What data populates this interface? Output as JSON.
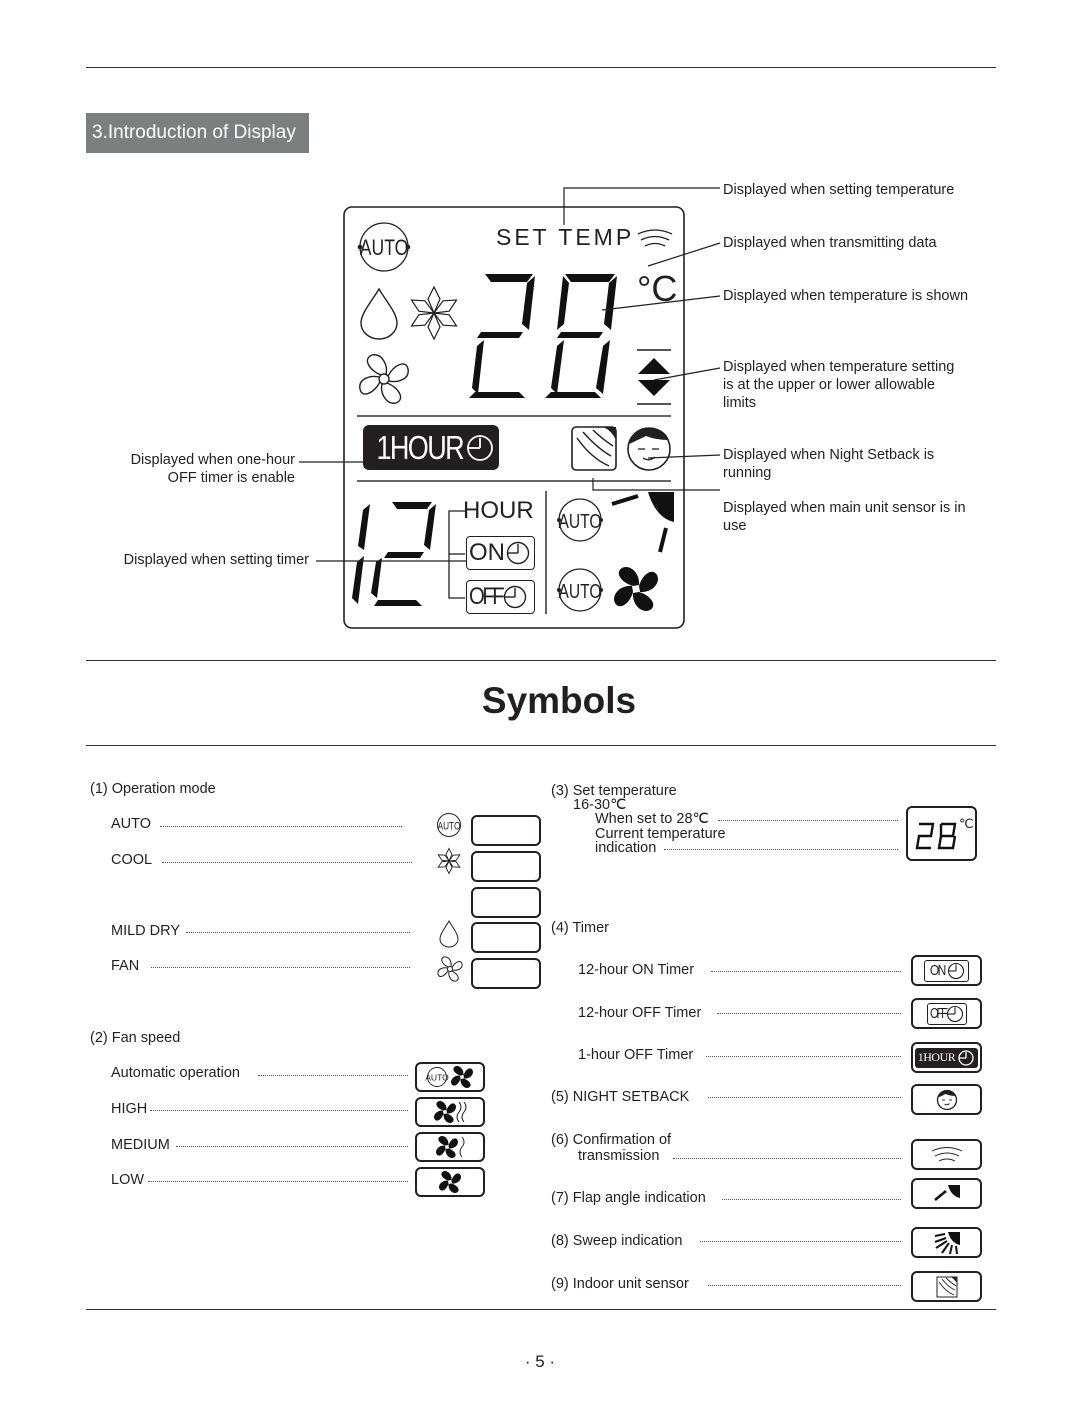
{
  "section": {
    "title": "3.Introduction of Display"
  },
  "display": {
    "set_temp_label": "SET TEMP",
    "temperature_digits": "28",
    "temperature_unit": "°C",
    "one_hour_label": "1HOUR",
    "timer_digits": "12",
    "hour_label": "HOUR",
    "on_label": "ON",
    "off_label": "OFF",
    "auto_label": "AUTO"
  },
  "callouts": {
    "setting_temperature": "Displayed when setting temperature",
    "transmitting_data": "Displayed when transmitting data",
    "temperature_shown": "Displayed when temperature is shown",
    "limits_line1": "Displayed when temperature setting",
    "limits_line2": "is at the upper or lower allowable",
    "limits_line3": "limits",
    "night_setback_line1": "Displayed when Night Setback is",
    "night_setback_line2": "running",
    "main_sensor_line1": "Displayed when main unit sensor is in",
    "main_sensor_line2": "use",
    "one_hour_off_line1": "Displayed when one-hour",
    "one_hour_off_line2": "OFF timer is enable",
    "setting_timer": "Displayed when setting timer"
  },
  "symbols_title": "Symbols",
  "operation_mode": {
    "heading": "(1) Operation mode",
    "items": [
      {
        "label": "AUTO",
        "icon": "auto-icon"
      },
      {
        "label": "COOL",
        "icon": "snowflake-icon"
      },
      {
        "label": "MILD DRY",
        "icon": "droplet-icon"
      },
      {
        "label": "FAN",
        "icon": "fan-icon"
      }
    ]
  },
  "fan_speed": {
    "heading": "(2) Fan speed",
    "items": [
      {
        "label": "Automatic operation",
        "icon": "auto-fan-icon"
      },
      {
        "label": "HIGH",
        "icon": "fan-high-icon"
      },
      {
        "label": "MEDIUM",
        "icon": "fan-medium-icon"
      },
      {
        "label": "LOW",
        "icon": "fan-low-icon"
      }
    ]
  },
  "set_temperature": {
    "heading": "(3) Set temperature",
    "range": "16-30℃",
    "line1": "When set to 28℃",
    "line2": "Current temperature",
    "line3": "indication",
    "display_value": "28",
    "display_unit": "℃"
  },
  "timer": {
    "heading": "(4) Timer",
    "items": [
      {
        "label": "12-hour ON Timer",
        "badge": "ON"
      },
      {
        "label": "12-hour OFF Timer",
        "badge": "OFF"
      },
      {
        "label": "1-hour OFF Timer",
        "badge": "1HOUR"
      }
    ]
  },
  "night_setback": {
    "label": "(5) NIGHT SETBACK"
  },
  "transmission": {
    "line1": "(6) Confirmation of",
    "line2": "transmission"
  },
  "flap_angle": {
    "label": "(7) Flap angle indication"
  },
  "sweep": {
    "label": "(8) Sweep indication"
  },
  "indoor_sensor": {
    "label": "(9) Indoor unit sensor"
  },
  "page_number": "· 5 ·"
}
